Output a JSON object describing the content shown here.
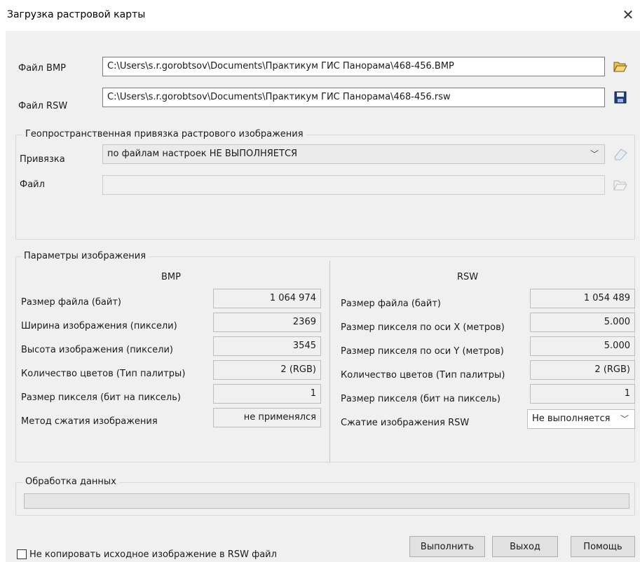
{
  "window": {
    "title": "Загрузка растровой карты"
  },
  "files": {
    "bmp_label": "Файл  BMP",
    "bmp_path": "C:\\Users\\s.r.gorobtsov\\Documents\\Практикум ГИС Панорама\\468-456.BMP",
    "rsw_label": "Файл  RSW",
    "rsw_path": "C:\\Users\\s.r.gorobtsov\\Documents\\Практикум ГИС Панорама\\468-456.rsw"
  },
  "georef": {
    "group_title": "Геопространственная привязка растрового изображения",
    "binding_label": "Привязка",
    "binding_value": "по файлам настроек НЕ ВЫПОЛНЯЕТСЯ",
    "file_label": "Файл",
    "file_value": ""
  },
  "params": {
    "group_title": "Параметры изображения",
    "bmp_header": "BMP",
    "rsw_header": "RSW",
    "bmp_rows": [
      {
        "label": "Размер файла (байт)",
        "value": "1 064 974"
      },
      {
        "label": "Ширина изображения (пиксели)",
        "value": "2369"
      },
      {
        "label": "Высота изображения (пиксели)",
        "value": "3545"
      },
      {
        "label": "Количество цветов (Тип палитры)",
        "value": "2 (RGB)"
      },
      {
        "label": "Размер пикселя (бит на пиксель)",
        "value": "1"
      },
      {
        "label": "Метод сжатия изображения",
        "value": "не применялся"
      }
    ],
    "rsw_rows": [
      {
        "label": "Размер файла (байт)",
        "value": "1 054 489"
      },
      {
        "label": "Размер пикселя по оси X (метров)",
        "value": "5.000"
      },
      {
        "label": "Размер пикселя по оси Y (метров)",
        "value": "5.000"
      },
      {
        "label": "Количество цветов (Тип палитры)",
        "value": "2 (RGB)"
      },
      {
        "label": "Размер пикселя (бит на пиксель)",
        "value": "1"
      }
    ],
    "rsw_compression_label": "Сжатие изображения RSW",
    "rsw_compression_value": "Не выполняется"
  },
  "processing": {
    "group_title": "Обработка данных",
    "progress": 0
  },
  "footer": {
    "checkbox_label": "Не копировать исходное изображение в RSW файл",
    "execute": "Выполнить",
    "exit": "Выход",
    "help": "Помощь"
  }
}
